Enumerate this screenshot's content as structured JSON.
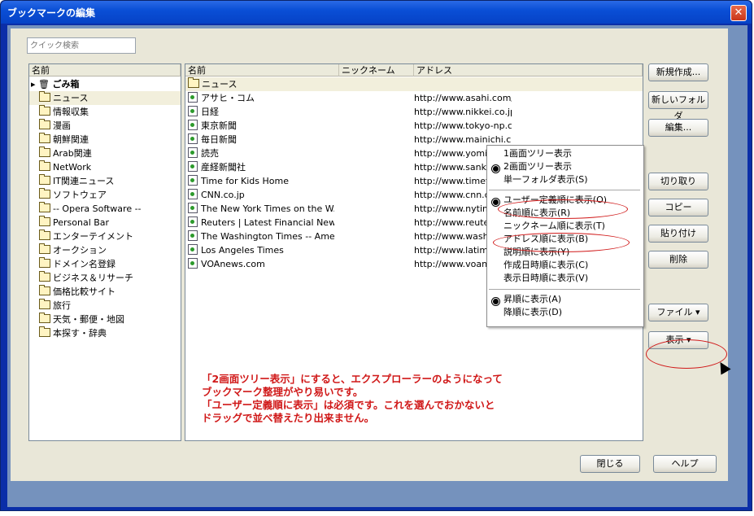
{
  "window": {
    "title": "ブックマークの編集",
    "close_label": "✕"
  },
  "search": {
    "placeholder": "クイック検索"
  },
  "left_pane": {
    "header": "名前",
    "items": [
      "ごみ箱",
      "ニュース",
      "情報収集",
      "漫画",
      "朝鮮関連",
      "Arab関連",
      "NetWork",
      "IT関連ニュース",
      "ソフトウェア",
      "-- Opera Software --",
      "Personal Bar",
      "エンターテイメント",
      "オークション",
      "ドメイン名登録",
      "ビジネス＆リサーチ",
      "価格比較サイト",
      "旅行",
      "天気・郵便・地図",
      "本探す・辞典"
    ]
  },
  "right_pane": {
    "headers": {
      "name": "名前",
      "nickname": "ニックネーム",
      "address": "アドレス"
    },
    "folder_row": "ニュース",
    "rows": [
      {
        "name": "アサヒ・コム",
        "address": "http://www.asahi.com/"
      },
      {
        "name": "日経",
        "address": "http://www.nikkei.co.jp/top.html"
      },
      {
        "name": "東京新聞",
        "address": "http://www.tokyo-np.co.jp/"
      },
      {
        "name": "毎日新聞",
        "address": "http://www.mainichi.co.jp/"
      },
      {
        "name": "読売",
        "address": "http://www.yomiuri.co.jp/"
      },
      {
        "name": "産経新聞社",
        "address": "http://www.sankei.co.jp/"
      },
      {
        "name": "Time for Kids  Home",
        "address": "http://www.timefork"
      },
      {
        "name": "CNN.co.jp",
        "address": "http://www.cnn.co.jp"
      },
      {
        "name": "The New York Times on the W..",
        "address": "http://www.nytimes."
      },
      {
        "name": "Reuters | Latest Financial New..",
        "address": "http://www.reuters."
      },
      {
        "name": "The Washington Times -- Ame..",
        "address": "http://www.washtim"
      },
      {
        "name": "Los Angeles Times",
        "address": "http://www.latimes.c"
      },
      {
        "name": "VOAnews.com",
        "address": "http://www.voanews"
      }
    ]
  },
  "buttons": {
    "new": "新規作成...",
    "new_folder": "新しいフォルダ",
    "edit": "編集...",
    "cut": "切り取り",
    "copy": "コピー",
    "paste": "貼り付け",
    "delete": "削除",
    "file": "ファイル ▾",
    "view": "表示 ▾",
    "close": "閉じる",
    "help": "ヘルプ"
  },
  "view_menu": {
    "items": [
      "1画面ツリー表示",
      "2画面ツリー表示",
      "単一フォルダ表示(S)",
      "ユーザー定義順に表示(O)",
      "名前順に表示(R)",
      "ニックネーム順に表示(T)",
      "アドレス順に表示(B)",
      "説明順に表示(Y)",
      "作成日時順に表示(C)",
      "表示日時順に表示(V)",
      "昇順に表示(A)",
      "降順に表示(D)"
    ]
  },
  "annotation": {
    "line1": "「2画面ツリー表示」にすると、エクスプローラーのようになって",
    "line2": "ブックマーク整理がやり易いです。",
    "line3": "「ユーザー定義順に表示」は必須です。これを選んでおかないと",
    "line4": "ドラッグで並べ替えたり出来ません。"
  },
  "colors": {
    "title_bar": "#0a4fd6",
    "annotation": "#d01818",
    "dialog_bg": "#e9e7d8"
  }
}
